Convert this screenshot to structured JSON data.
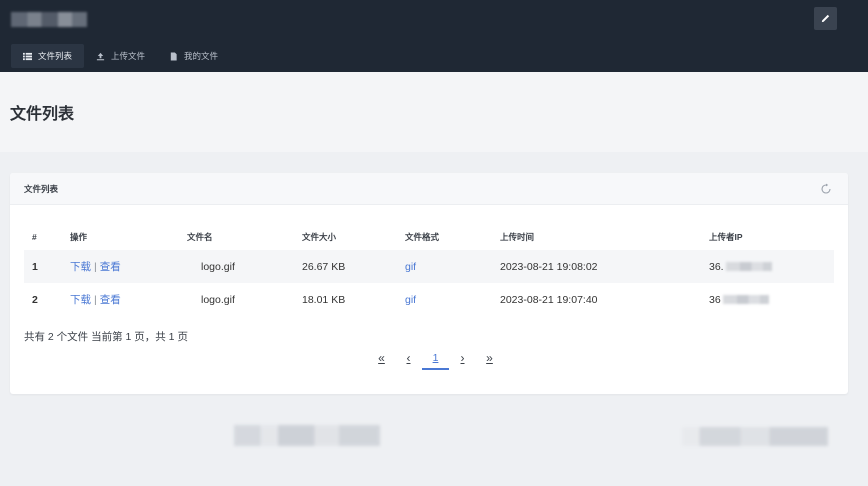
{
  "header": {
    "nav": [
      {
        "label": "文件列表",
        "icon": "list-icon",
        "active": true
      },
      {
        "label": "上传文件",
        "icon": "upload-icon",
        "active": false
      },
      {
        "label": "我的文件",
        "icon": "file-icon",
        "active": false
      }
    ]
  },
  "page": {
    "title": "文件列表"
  },
  "card": {
    "title": "文件列表",
    "columns": [
      "#",
      "操作",
      "文件名",
      "文件大小",
      "文件格式",
      "上传时间",
      "上传者IP"
    ],
    "rows": [
      {
        "index": "1",
        "download": "下载",
        "sep": "|",
        "view": "查看",
        "name": "logo.gif",
        "size": "26.67 KB",
        "format": "gif",
        "time": "2023-08-21 19:08:02",
        "ip": "36."
      },
      {
        "index": "2",
        "download": "下载",
        "sep": "|",
        "view": "查看",
        "name": "logo.gif",
        "size": "18.01 KB",
        "format": "gif",
        "time": "2023-08-21 19:07:40",
        "ip": "36"
      }
    ],
    "summary": "共有 2 个文件  当前第 1 页，共 1 页",
    "pagination": {
      "first": "«",
      "prev": "‹",
      "current": "1",
      "next": "›",
      "last": "»"
    }
  },
  "colors": {
    "topbar": "#1f2834",
    "link": "#4a78d4",
    "background": "#eef0f3"
  }
}
